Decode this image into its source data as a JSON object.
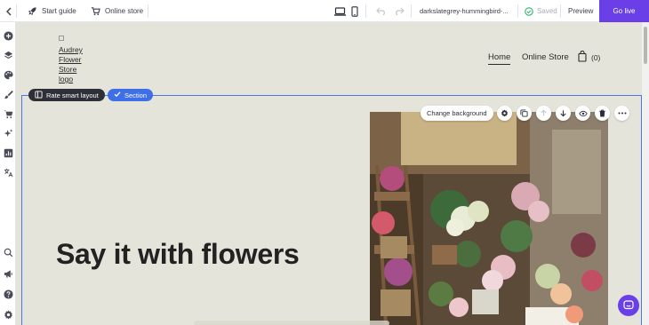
{
  "topbar": {
    "start_guide": "Start guide",
    "online_store": "Online store",
    "site_name": "darkslategrey-hummingbird-...",
    "saved": "Saved",
    "preview": "Preview",
    "go_live": "Go live"
  },
  "site": {
    "logo_alt": "Audrey Store logo",
    "logo_lines": [
      "Audrey",
      "Flower",
      "Store",
      "logo"
    ],
    "nav": [
      "Home",
      "Online Store"
    ],
    "cart_count": "(0)",
    "headline": "Say it with flowers"
  },
  "editor": {
    "rate_layout": "Rate smart layout",
    "section": "Section",
    "change_background": "Change background"
  },
  "colors": {
    "accent": "#6b3fe8",
    "selection": "#3f6fe6",
    "canvas_bg": "#e5e4da"
  },
  "rail_icons": [
    "back-icon",
    "add-icon",
    "layers-icon",
    "palette-icon",
    "brush-icon",
    "cart-icon",
    "sparkle-icon",
    "analytics-icon",
    "translate-icon",
    "search-icon",
    "megaphone-icon",
    "help-icon",
    "settings-icon"
  ]
}
